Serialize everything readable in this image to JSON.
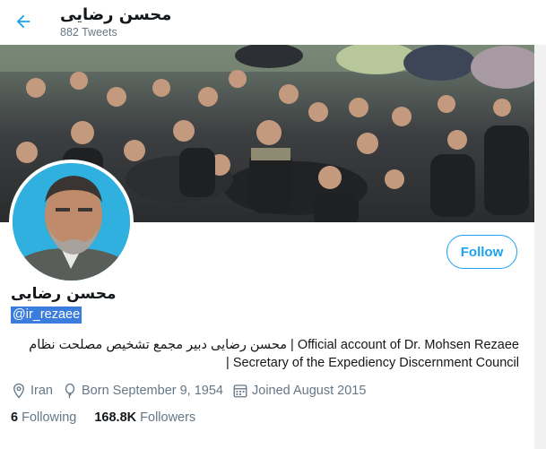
{
  "header": {
    "title": "محسن رضایی",
    "tweet_count": "882 Tweets"
  },
  "profile": {
    "name": "محسن رضایی",
    "handle": "@ir_rezaee",
    "follow_label": "Follow",
    "bio_line1": "محسن رضایی دبیر مجمع تشخیص مصلحت نظام | Official account of Dr. Mohsen Rezaee",
    "bio_line2": "| Secretary of the Expediency Discernment Council",
    "location": "Iran",
    "birthday": "Born September 9, 1954",
    "joined": "Joined August 2015",
    "following_count": "6",
    "following_label": "Following",
    "followers_count": "168.8K",
    "followers_label": "Followers"
  },
  "icons": {
    "back": "arrow-left-icon",
    "location": "location-pin-icon",
    "birthday": "balloon-icon",
    "joined": "calendar-icon"
  },
  "colors": {
    "accent": "#1da1f2",
    "secondary_text": "#657786",
    "selection": "#3b7ddd"
  }
}
